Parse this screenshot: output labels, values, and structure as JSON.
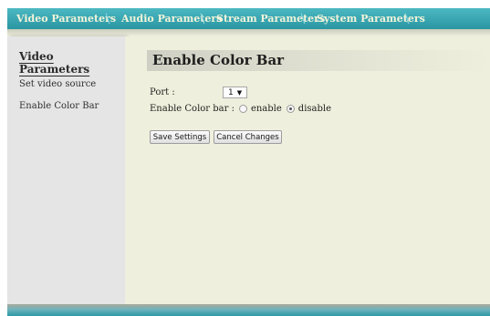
{
  "tabs": [
    {
      "label": "Video Parameters"
    },
    {
      "label": "Audio Parameters"
    },
    {
      "label": "Stream Parameters"
    },
    {
      "label": "System Parameters"
    }
  ],
  "sidebar": {
    "heading": "Video Parameters",
    "items": [
      {
        "label": "Set video source"
      },
      {
        "label": "Enable Color Bar"
      }
    ]
  },
  "main": {
    "title": "Enable Color Bar",
    "port_label": "Port :",
    "port_value": "1",
    "colorbar_label": "Enable Color bar :",
    "options": [
      {
        "label": "enable",
        "checked": false
      },
      {
        "label": "disable",
        "checked": true
      }
    ],
    "save_label": "Save Settings",
    "cancel_label": "Cancel Changes"
  },
  "colors": {
    "tab_bar": "#2a96a2",
    "tab_text": "#f2f4da",
    "content_bg": "#efefdd",
    "sidebar_bg": "#e5e5e5"
  }
}
